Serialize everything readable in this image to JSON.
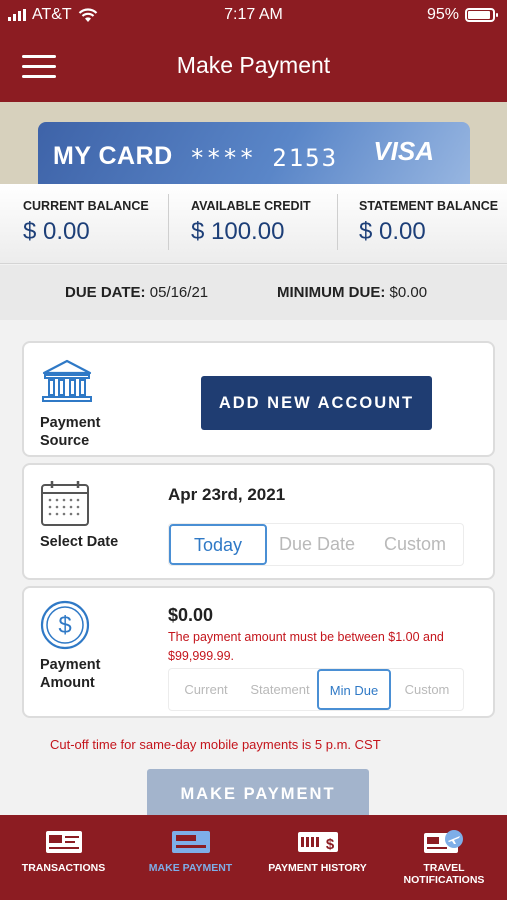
{
  "status_bar": {
    "carrier": "AT&T",
    "time": "7:17 AM",
    "battery": "95%"
  },
  "header": {
    "title": "Make Payment"
  },
  "card": {
    "name": "MY CARD",
    "number": "**** 2153",
    "brand": "VISA"
  },
  "balances": [
    {
      "label": "CURRENT BALANCE",
      "value": "$ 0.00"
    },
    {
      "label": "AVAILABLE CREDIT",
      "value": "$ 100.00"
    },
    {
      "label": "STATEMENT BALANCE",
      "value": "$ 0.00"
    }
  ],
  "due": {
    "due_label": "DUE DATE:",
    "due_value": "05/16/21",
    "min_label": "MINIMUM DUE:",
    "min_value": "$0.00"
  },
  "payment_source": {
    "label_line1": "Payment",
    "label_line2": "Source",
    "button": "ADD NEW ACCOUNT"
  },
  "select_date": {
    "label": "Select Date",
    "date": "Apr 23rd, 2021",
    "options": [
      "Today",
      "Due Date",
      "Custom"
    ],
    "selected": "Today"
  },
  "payment_amount": {
    "label_line1": "Payment",
    "label_line2": "Amount",
    "amount": "$0.00",
    "error": "The payment amount must be between $1.00 and $99,999.99.",
    "options": [
      "Current",
      "Statement",
      "Min Due",
      "Custom"
    ],
    "selected": "Min Due"
  },
  "cutoff_note": "Cut-off time for same-day mobile payments is 5 p.m. CST",
  "submit": {
    "label": "MAKE PAYMENT"
  },
  "bottom_nav": {
    "items": [
      {
        "label_line1": "TRANSACTIONS",
        "label_line2": "",
        "icon": "transactions-icon"
      },
      {
        "label_line1": "MAKE PAYMENT",
        "label_line2": "",
        "icon": "make-payment-icon"
      },
      {
        "label_line1": "PAYMENT HISTORY",
        "label_line2": "",
        "icon": "payment-history-icon"
      },
      {
        "label_line1": "TRAVEL",
        "label_line2": "NOTIFICATIONS",
        "icon": "travel-icon"
      }
    ],
    "active_index": 1
  },
  "colors": {
    "brand": "#8c1c22",
    "navy": "#1f3d72",
    "error": "#c4151c",
    "active": "#4a8fd4",
    "inactive_button": "#a3b4cc"
  }
}
